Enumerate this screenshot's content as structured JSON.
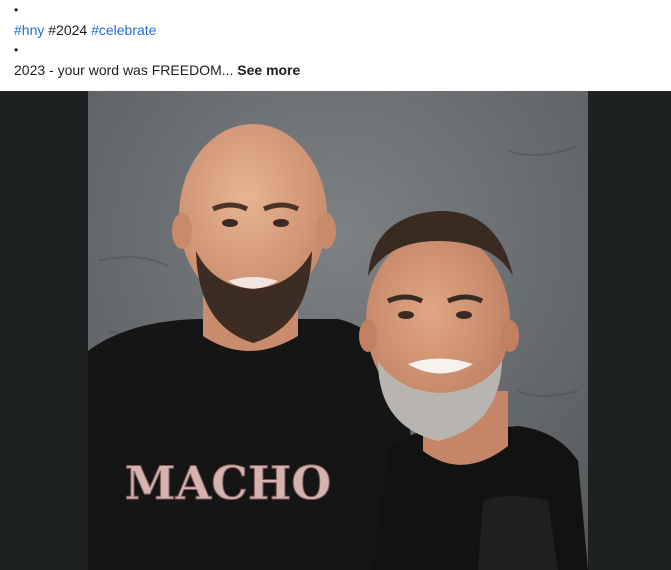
{
  "post": {
    "bullet": "•",
    "tags": [
      {
        "text": "#hny",
        "link": true
      },
      {
        "text": "#2024",
        "link": false
      },
      {
        "text": "#celebrate",
        "link": true
      }
    ],
    "text": "2023 - your word was FREEDOM...",
    "see_more_label": "See more"
  },
  "media": {
    "shirt_text": "MACHO",
    "colors": {
      "letterbox": "#1d2122",
      "wall": "#6b6f72",
      "skin": "#d9a07e",
      "shirt": "#151515",
      "link": "#216fdb"
    }
  }
}
